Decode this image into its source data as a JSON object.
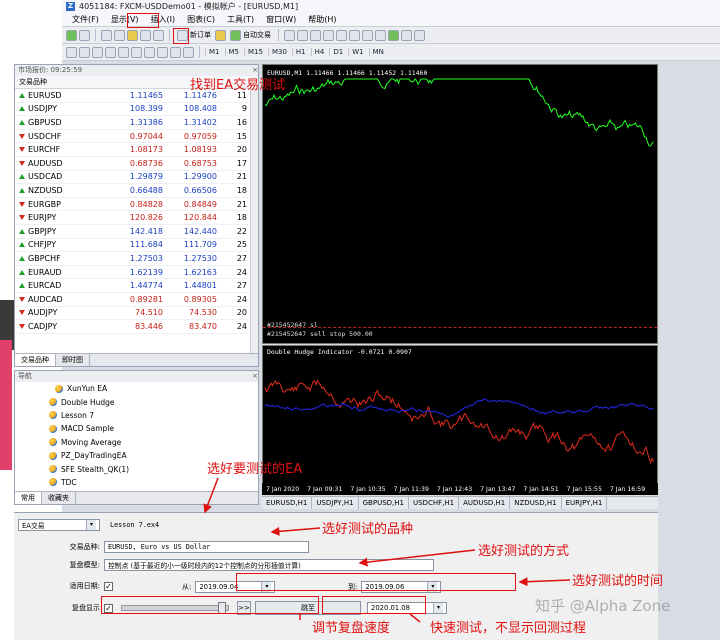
{
  "window": {
    "title": "4051184: FXCM-USDDemo01 - 模拟帐户 - [EURUSD,M1]"
  },
  "menu": [
    "文件(F)",
    "显示(V)",
    "插入(I)",
    "图表(C)",
    "工具(T)",
    "窗口(W)",
    "帮助(H)"
  ],
  "toolbar": {
    "new_order": "新订单",
    "auto_trade": "自动交易",
    "timeframes": [
      "M1",
      "M5",
      "M15",
      "M30",
      "H1",
      "H4",
      "D1",
      "W1",
      "MN"
    ]
  },
  "market_watch": {
    "title": "市场报价: 09:25:59",
    "headers": {
      "symbol": "交易品种",
      "bid": "",
      "ask": "",
      "spread": ""
    },
    "rows": [
      {
        "symbol": "EURUSD",
        "bid": "1.11465",
        "ask": "1.11476",
        "spread": "11",
        "dir": "up"
      },
      {
        "symbol": "USDJPY",
        "bid": "108.399",
        "ask": "108.408",
        "spread": "9",
        "dir": "up"
      },
      {
        "symbol": "GBPUSD",
        "bid": "1.31386",
        "ask": "1.31402",
        "spread": "16",
        "dir": "up"
      },
      {
        "symbol": "USDCHF",
        "bid": "0.97044",
        "ask": "0.97059",
        "spread": "15",
        "dir": "dn"
      },
      {
        "symbol": "EURCHF",
        "bid": "1.08173",
        "ask": "1.08193",
        "spread": "20",
        "dir": "dn"
      },
      {
        "symbol": "AUDUSD",
        "bid": "0.68736",
        "ask": "0.68753",
        "spread": "17",
        "dir": "dn"
      },
      {
        "symbol": "USDCAD",
        "bid": "1.29879",
        "ask": "1.29900",
        "spread": "21",
        "dir": "up"
      },
      {
        "symbol": "NZDUSD",
        "bid": "0.66488",
        "ask": "0.66506",
        "spread": "18",
        "dir": "up"
      },
      {
        "symbol": "EURGBP",
        "bid": "0.84828",
        "ask": "0.84849",
        "spread": "21",
        "dir": "dn"
      },
      {
        "symbol": "EURJPY",
        "bid": "120.826",
        "ask": "120.844",
        "spread": "18",
        "dir": "dn"
      },
      {
        "symbol": "GBPJPY",
        "bid": "142.418",
        "ask": "142.440",
        "spread": "22",
        "dir": "up"
      },
      {
        "symbol": "CHFJPY",
        "bid": "111.684",
        "ask": "111.709",
        "spread": "25",
        "dir": "up"
      },
      {
        "symbol": "GBPCHF",
        "bid": "1.27503",
        "ask": "1.27530",
        "spread": "27",
        "dir": "up"
      },
      {
        "symbol": "EURAUD",
        "bid": "1.62139",
        "ask": "1.62163",
        "spread": "24",
        "dir": "up"
      },
      {
        "symbol": "EURCAD",
        "bid": "1.44774",
        "ask": "1.44801",
        "spread": "27",
        "dir": "up"
      },
      {
        "symbol": "AUDCAD",
        "bid": "0.89281",
        "ask": "0.89305",
        "spread": "24",
        "dir": "dn"
      },
      {
        "symbol": "AUDJPY",
        "bid": "74.510",
        "ask": "74.530",
        "spread": "20",
        "dir": "dn"
      },
      {
        "symbol": "CADJPY",
        "bid": "83.446",
        "ask": "83.470",
        "spread": "24",
        "dir": "dn"
      }
    ],
    "tabs": [
      "交易品种",
      "即时图"
    ]
  },
  "navigator": {
    "title": "导航",
    "items": [
      "XunYun EA",
      "Double Hudge",
      "Lesson 7",
      "MACD Sample",
      "Moving Average",
      "PZ_DayTradingEA",
      "SFE Stealth_QK(1)",
      "TDC"
    ],
    "tabs": [
      "常用",
      "收藏夹"
    ]
  },
  "chart_main": {
    "label": "EURUSD,M1  1.11466 1.11466 1.11452 1.11460",
    "order_lines": [
      "#215452647 sl",
      "#215452647 sell stop 500.00"
    ]
  },
  "chart_indicator": {
    "label": "Double Hudge Indicator -0.0721 0.0907"
  },
  "time_axis": [
    "7 Jan 2020",
    "7 Jan 09:31",
    "7 Jan 10:35",
    "7 Jan 11:39",
    "7 Jan 12:43",
    "7 Jan 13:47",
    "7 Jan 14:51",
    "7 Jan 15:55",
    "7 Jan 16:59"
  ],
  "chart_tabs": [
    "EURUSD,H1",
    "USDJPY,H1",
    "GBPUSD,H1",
    "USDCHF,H1",
    "AUDUSD,H1",
    "NZDUSD,H1",
    "EURJPY,H1"
  ],
  "tester": {
    "type": "EA交易",
    "ea_file": "Lesson 7.ex4",
    "symbol_label": "交易品种:",
    "symbol_value": "EURUSD, Euro vs US Dollar",
    "model_label": "复盘模型:",
    "model_value": "控制点 (基于最近的小一级时段内的12个控制点的分形插值计算)",
    "date_label": "适用日期:",
    "from_label": "从:",
    "from_value": "2019.09.04",
    "to_label": "到:",
    "to_value": "2019.09.06",
    "visual_label": "复盘显示",
    "skip_button": "跳至",
    "skip_date": "2020.01.08",
    "ff_button": ">>"
  },
  "annotations": {
    "find_ea": "找到EA交易测试",
    "select_ea": "选好要测试的EA",
    "select_symbol": "选好测试的品种",
    "select_method": "选好测试的方式",
    "select_time": "选好测试的时间",
    "adjust_speed": "调节复盘速度",
    "fast_test": "快速测试，不显示回测过程"
  },
  "watermark": "知乎 @Alpha Zone",
  "colors": {
    "up": "#1a3fc0",
    "down": "#c51f16",
    "price_line": "#22ff22",
    "annotation": "#e01010"
  }
}
